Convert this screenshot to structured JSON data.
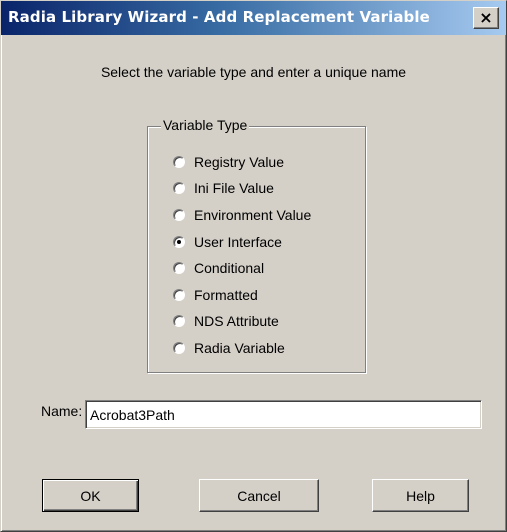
{
  "window": {
    "title": "Radia Library Wizard - Add Replacement Variable",
    "close_label": "×"
  },
  "instruction": "Select the variable type and enter a unique name",
  "variable_type": {
    "legend": "Variable Type",
    "options": [
      {
        "label": "Registry Value",
        "checked": false
      },
      {
        "label": "Ini File Value",
        "checked": false
      },
      {
        "label": "Environment Value",
        "checked": false
      },
      {
        "label": "User Interface",
        "checked": true
      },
      {
        "label": "Conditional",
        "checked": false
      },
      {
        "label": "Formatted",
        "checked": false
      },
      {
        "label": "NDS Attribute",
        "checked": false
      },
      {
        "label": "Radia Variable",
        "checked": false
      }
    ]
  },
  "name_field": {
    "label": "Name:",
    "value": "Acrobat3Path"
  },
  "buttons": {
    "ok": "OK",
    "cancel": "Cancel",
    "help": "Help"
  },
  "colors": {
    "titlebar_start": "#0a246a",
    "titlebar_end": "#a6caf0",
    "dialog_face": "#d4d0c8"
  }
}
